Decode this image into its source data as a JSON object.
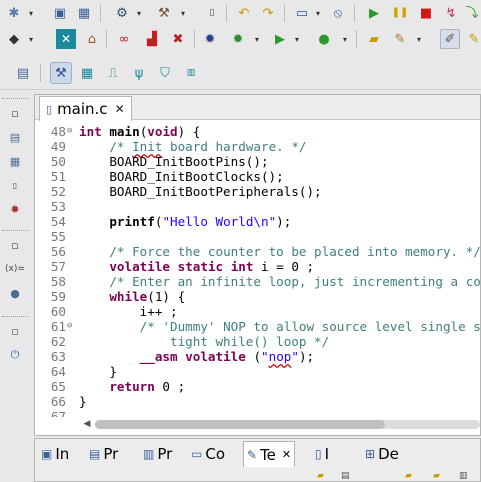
{
  "colors": {
    "keyword": "#7f0055",
    "comment": "#3f7f7f",
    "string": "#2a00ff",
    "line_number": "#787878"
  },
  "main_toolbar": [
    {
      "name": "new-icon",
      "glyph": "✱"
    },
    {
      "name": "save-icon",
      "glyph": "▣"
    },
    {
      "name": "save-all-icon",
      "glyph": "▦"
    },
    {
      "name": "project-settings-icon",
      "glyph": "⚙"
    },
    {
      "name": "build-icon",
      "glyph": "⚒"
    },
    {
      "name": "binary-icon",
      "glyph": "▯"
    },
    {
      "name": "undo-icon",
      "glyph": "↶"
    },
    {
      "name": "redo-icon",
      "glyph": "↷"
    },
    {
      "name": "terminal-icon",
      "glyph": "▭"
    },
    {
      "name": "skip-breakpoints-icon",
      "glyph": "⦸"
    },
    {
      "name": "resume-icon",
      "glyph": "▶"
    },
    {
      "name": "suspend-icon",
      "glyph": "❚❚"
    },
    {
      "name": "terminate-icon",
      "glyph": "■"
    },
    {
      "name": "disconnect-icon",
      "glyph": "↯"
    }
  ],
  "second_toolbar": [
    {
      "name": "debug-config-icon",
      "glyph": "◆"
    },
    {
      "name": "chip-icon",
      "glyph": "▣"
    },
    {
      "name": "home-icon",
      "glyph": "⌂"
    },
    {
      "name": "link-icon",
      "glyph": "∞"
    },
    {
      "name": "probe-icon",
      "glyph": "▟"
    },
    {
      "name": "remove-icon",
      "glyph": "✖"
    },
    {
      "name": "bug-icon",
      "glyph": "✹"
    },
    {
      "name": "debug-icon",
      "glyph": "✹"
    },
    {
      "name": "run-icon",
      "glyph": "▶"
    },
    {
      "name": "external-tools-icon",
      "glyph": "●"
    },
    {
      "name": "open-folder-icon",
      "glyph": "▰"
    },
    {
      "name": "pencil-icon",
      "glyph": "✎"
    },
    {
      "name": "edit-icon",
      "glyph": "✐"
    }
  ],
  "perspectives": [
    {
      "name": "open-perspective-icon",
      "glyph": "▤",
      "active": false
    },
    {
      "name": "develop-perspective-icon",
      "glyph": "⚒",
      "active": true
    },
    {
      "name": "pins-perspective-icon",
      "glyph": "▦",
      "active": false
    },
    {
      "name": "clocks-perspective-icon",
      "glyph": "⎍",
      "active": false
    },
    {
      "name": "peripherals-perspective-icon",
      "glyph": "ψ",
      "active": false
    },
    {
      "name": "tee-perspective-icon",
      "glyph": "⛉",
      "active": false
    },
    {
      "name": "memory-perspective-icon",
      "glyph": "▥",
      "active": false
    }
  ],
  "editor": {
    "tab_title": "main.c"
  },
  "code_lines": [
    {
      "num": "48",
      "fold": "⊖",
      "html": "<span class=\"kw\">int</span> <b>main</b>(<span class=\"kw\">void</span>) {"
    },
    {
      "num": "49",
      "fold": "",
      "html": "    <span class=\"cm\">/* <span class=\"ul\">Init</span> board hardware. */</span>"
    },
    {
      "num": "50",
      "fold": "",
      "html": "    BOARD_InitBootPins();"
    },
    {
      "num": "51",
      "fold": "",
      "html": "    BOARD_InitBootClocks();"
    },
    {
      "num": "52",
      "fold": "",
      "html": "    BOARD_InitBootPeripherals();"
    },
    {
      "num": "53",
      "fold": "",
      "html": ""
    },
    {
      "num": "54",
      "fold": "",
      "html": "    <b>printf</b>(<span class=\"str\">\"Hello World\\n\"</span>);"
    },
    {
      "num": "55",
      "fold": "",
      "html": ""
    },
    {
      "num": "56",
      "fold": "",
      "html": "    <span class=\"cm\">/* Force the counter to be placed into memory. */</span>"
    },
    {
      "num": "57",
      "fold": "",
      "html": "    <span class=\"kw\">volatile</span> <span class=\"kw\">static</span> <span class=\"kw\">int</span> i = 0 ;"
    },
    {
      "num": "58",
      "fold": "",
      "html": "    <span class=\"cm\">/* Enter an infinite loop, just incrementing a counter. */</span>"
    },
    {
      "num": "59",
      "fold": "",
      "html": "    <span class=\"kw\">while</span>(1) {"
    },
    {
      "num": "60",
      "fold": "",
      "html": "        i++ ;"
    },
    {
      "num": "61",
      "fold": "⊖",
      "html": "        <span class=\"cm\">/* 'Dummy' NOP to allow source level single stepping of</span>"
    },
    {
      "num": "62",
      "fold": "",
      "html": "<span class=\"cm\">            tight while() loop */</span>"
    },
    {
      "num": "63",
      "fold": "",
      "html": "        <span class=\"kw\">__asm</span> <span class=\"kw\">volatile</span> (<span class=\"str\">\"<span class=\"ul\">nop</span>\"</span>);"
    },
    {
      "num": "64",
      "fold": "",
      "html": "    }"
    },
    {
      "num": "65",
      "fold": "",
      "html": "    <span class=\"kw\">return</span> 0 ;"
    },
    {
      "num": "66",
      "fold": "",
      "html": "}"
    },
    {
      "num": "67",
      "fold": "",
      "html": ""
    }
  ],
  "bottom_tabs": [
    {
      "label": "In",
      "icon": "▣",
      "active": false
    },
    {
      "label": "Pr",
      "icon": "▤",
      "active": false
    },
    {
      "label": "Pr",
      "icon": "▥",
      "active": false
    },
    {
      "label": "Co",
      "icon": "▭",
      "active": false
    },
    {
      "label": "Te",
      "icon": "✎",
      "active": true
    },
    {
      "label": "I",
      "icon": "▯",
      "active": false
    },
    {
      "label": "De",
      "icon": "⊞",
      "active": false
    }
  ]
}
